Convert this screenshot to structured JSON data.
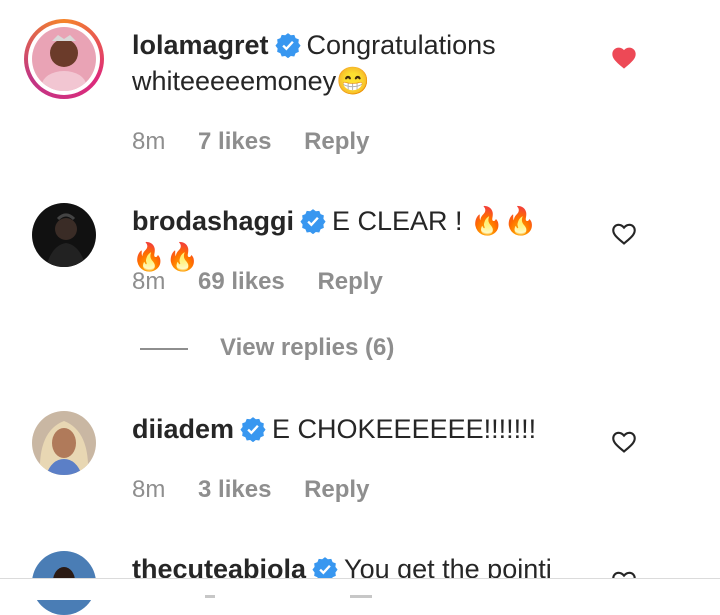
{
  "comments": [
    {
      "username": "lolamagret",
      "text": "Congratulations whiteeeeemoney",
      "emoji": "😁",
      "time": "8m",
      "likes": "7 likes",
      "reply": "Reply",
      "liked": true,
      "avatar_icon": "profile-photo-lolamagret"
    },
    {
      "username": "brodashaggi",
      "text": "E CLEAR ! 🔥🔥🔥🔥",
      "time": "8m",
      "likes": "69 likes",
      "reply": "Reply",
      "liked": false,
      "avatar_icon": "profile-photo-brodashaggi"
    },
    {
      "username": "diiadem",
      "text": "E CHOKEEEEEE!!!!!!!",
      "time": "8m",
      "likes": "3 likes",
      "reply": "Reply",
      "liked": false,
      "avatar_icon": "profile-photo-diiadem"
    },
    {
      "username": "thecuteabiola",
      "text": "You get the pointi",
      "liked": false,
      "avatar_icon": "profile-photo-thecuteabiola"
    }
  ],
  "view_replies": "View replies (6)",
  "colors": {
    "liked_heart": "#ed4956",
    "verified_badge": "#3897f0",
    "meta_text": "#8e8e8e"
  }
}
